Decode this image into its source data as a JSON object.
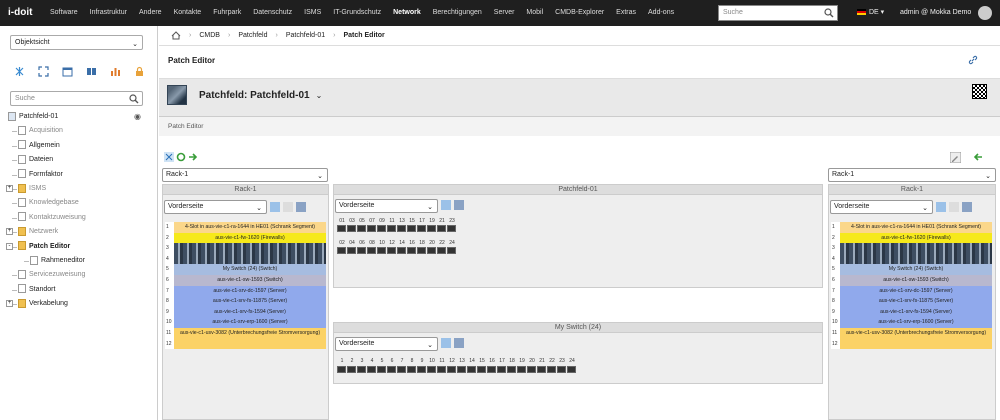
{
  "nav": {
    "logo": "i-doit",
    "items": [
      "Software",
      "Infrastruktur",
      "Andere",
      "Kontakte",
      "Fuhrpark",
      "Datenschutz",
      "ISMS",
      "IT-Grundschutz",
      "Network",
      "Berechtigungen",
      "Server",
      "Mobil",
      "CMDB-Explorer",
      "Extras",
      "Add-ons"
    ],
    "active": "Network",
    "search_placeholder": "Suche",
    "lang": "DE",
    "user": "admin @ Mokka Demo"
  },
  "sidebar": {
    "view_select": "Objektsicht",
    "search_placeholder": "Suche",
    "tree": [
      {
        "label": "Patchfeld-01",
        "kind": "root",
        "style": "normal"
      },
      {
        "label": "Acquisition",
        "kind": "doc",
        "style": "dim"
      },
      {
        "label": "Allgemein",
        "kind": "doc",
        "style": "normal"
      },
      {
        "label": "Dateien",
        "kind": "doc",
        "style": "normal"
      },
      {
        "label": "Formfaktor",
        "kind": "doc",
        "style": "normal"
      },
      {
        "label": "ISMS",
        "kind": "folder",
        "style": "dim",
        "expander": "+"
      },
      {
        "label": "Knowledgebase",
        "kind": "doc",
        "style": "dim"
      },
      {
        "label": "Kontaktzuweisung",
        "kind": "doc",
        "style": "dim"
      },
      {
        "label": "Netzwerk",
        "kind": "folder",
        "style": "dim",
        "expander": "+"
      },
      {
        "label": "Patch Editor",
        "kind": "folder",
        "style": "bold",
        "expander": "-"
      },
      {
        "label": "Rahmeneditor",
        "kind": "doc",
        "style": "normal",
        "indent": true
      },
      {
        "label": "Servicezuweisung",
        "kind": "doc",
        "style": "dim"
      },
      {
        "label": "Standort",
        "kind": "doc",
        "style": "normal"
      },
      {
        "label": "Verkabelung",
        "kind": "folder",
        "style": "normal",
        "expander": "+"
      }
    ]
  },
  "breadcrumb": [
    "CMDB",
    "Patchfeld",
    "Patchfeld-01",
    "Patch Editor"
  ],
  "page_title": "Patch Editor",
  "object_title": "Patchfeld: Patchfeld-01",
  "sub_title": "Patch Editor",
  "left_rack_select": "Rack-1",
  "right_rack_select": "Rack-1",
  "left_rack": {
    "title": "Rack-1",
    "side_select": "Vorderseite",
    "slots": [
      {
        "n": "1",
        "label": "4-Slot in aus-vie-c1-ra-1644 in HE01 (Schrank Segment)",
        "color": "#fbd78a"
      },
      {
        "n": "2",
        "label": "aus-vie-c1-fw-1620 (Firewalls)",
        "color": "#f6e91a"
      },
      {
        "n": "3",
        "label": "",
        "color": "#55687e",
        "img": true
      },
      {
        "n": "4",
        "label": "",
        "color": "#55687e",
        "img": true
      },
      {
        "n": "5",
        "label": "My Switch (24) (Switch)",
        "color": "#a6bce0"
      },
      {
        "n": "6",
        "label": "aus-vie-c1-sw-1593 (Switch)",
        "color": "#b8b8cf"
      },
      {
        "n": "7",
        "label": "aus-vie-c1-srv-dc-1597 (Server)",
        "color": "#90a9ec"
      },
      {
        "n": "8",
        "label": "aus-vie-c1-srv-fs-11875 (Server)",
        "color": "#90a9ec"
      },
      {
        "n": "9",
        "label": "aus-vie-c1-srv-fs-1594 (Server)",
        "color": "#90a9ec"
      },
      {
        "n": "10",
        "label": "aus-vie-c1-srv-erp-1600 (Server)",
        "color": "#90a9ec"
      },
      {
        "n": "11",
        "label": "aus-vie-c1-usv-3082 (Unterbrechungsfreie Stromversorgung)",
        "color": "#fbd266"
      },
      {
        "n": "12",
        "label": "",
        "color": "#fbd266"
      }
    ]
  },
  "right_rack": {
    "title": "Rack-1",
    "side_select": "Vorderseite",
    "slots": [
      {
        "n": "1",
        "label": "4-Slot in aus-vie-c1-ra-1644 in HE01 (Schrank Segment)",
        "color": "#fbd78a"
      },
      {
        "n": "2",
        "label": "aus-vie-c1-fw-1620 (Firewalls)",
        "color": "#f6e91a"
      },
      {
        "n": "3",
        "label": "",
        "color": "#55687e",
        "img": true
      },
      {
        "n": "4",
        "label": "",
        "color": "#55687e",
        "img": true
      },
      {
        "n": "5",
        "label": "My Switch (24) (Switch)",
        "color": "#a6bce0"
      },
      {
        "n": "6",
        "label": "aus-vie-c1-sw-1593 (Switch)",
        "color": "#b8b8cf"
      },
      {
        "n": "7",
        "label": "aus-vie-c1-srv-dc-1597 (Server)",
        "color": "#90a9ec"
      },
      {
        "n": "8",
        "label": "aus-vie-c1-srv-fs-11875 (Server)",
        "color": "#90a9ec"
      },
      {
        "n": "9",
        "label": "aus-vie-c1-srv-fs-1594 (Server)",
        "color": "#90a9ec"
      },
      {
        "n": "10",
        "label": "aus-vie-c1-srv-erp-1600 (Server)",
        "color": "#90a9ec"
      },
      {
        "n": "11",
        "label": "aus-vie-c1-usv-3082 (Unterbrechungsfreie Stromversorgung)",
        "color": "#fbd266"
      },
      {
        "n": "12",
        "label": "",
        "color": "#fbd266"
      }
    ]
  },
  "patchfeld": {
    "title": "Patchfeld-01",
    "side_select": "Vorderseite",
    "top_labels": [
      "01",
      "03",
      "05",
      "07",
      "09",
      "11",
      "13",
      "15",
      "17",
      "19",
      "21",
      "23"
    ],
    "bottom_labels": [
      "02",
      "04",
      "06",
      "08",
      "10",
      "12",
      "14",
      "16",
      "18",
      "20",
      "22",
      "24"
    ]
  },
  "switch": {
    "title": "My Switch (24)",
    "side_select": "Vorderseite",
    "labels": [
      "1",
      "2",
      "3",
      "4",
      "5",
      "6",
      "7",
      "8",
      "9",
      "10",
      "11",
      "12",
      "13",
      "14",
      "15",
      "16",
      "17",
      "18",
      "19",
      "20",
      "21",
      "22",
      "23",
      "24"
    ]
  },
  "colors": {
    "nav_bg": "#1f1f1f",
    "accent_green": "#3a9d3a"
  }
}
